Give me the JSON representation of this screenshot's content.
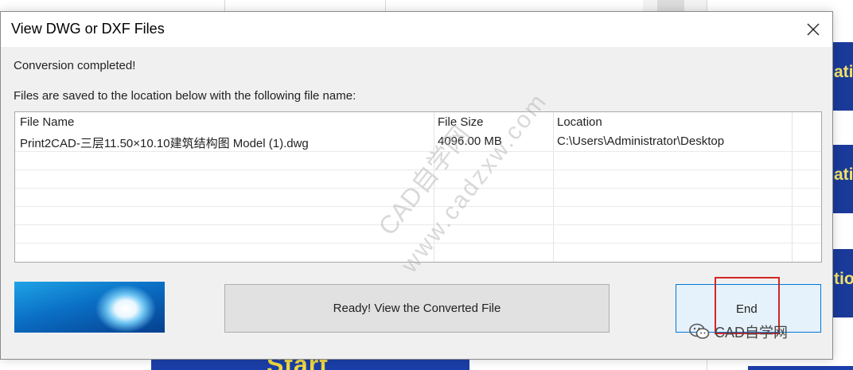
{
  "dialog": {
    "title": "View DWG or DXF Files",
    "status": "Conversion completed!",
    "location_message": "Files are saved to the location below with the following file name:"
  },
  "table": {
    "columns": [
      "File Name",
      "File Size",
      "Location"
    ],
    "rows": [
      {
        "file_name": "Print2CAD-三层11.50×10.10建筑结构图 Model (1).dwg",
        "file_size": "4096.00 MB",
        "location": "C:\\Users\\Administrator\\Desktop"
      }
    ]
  },
  "buttons": {
    "view_label": "Ready! View the Converted File",
    "end_label": "End"
  },
  "background": {
    "tile_text": [
      "ati",
      "ati",
      "tio"
    ],
    "bottom_text": "Start"
  },
  "watermark": {
    "line1": "CAD自学网",
    "line2": "www.cadzxw.com"
  },
  "logo": {
    "text": "CAD自学网"
  },
  "colors": {
    "accent": "#0078d7",
    "highlight": "#d42525",
    "tile_blue": "#1a3a9a"
  }
}
